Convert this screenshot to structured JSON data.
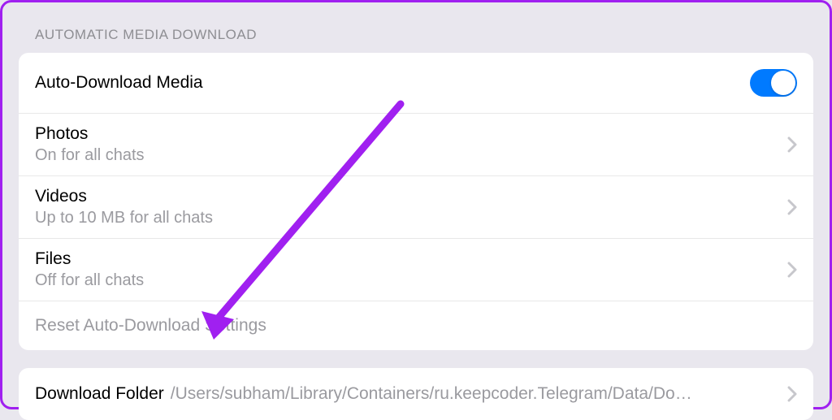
{
  "section_header": "AUTOMATIC MEDIA DOWNLOAD",
  "auto_download": {
    "label": "Auto-Download Media",
    "enabled": true
  },
  "media_types": [
    {
      "label": "Photos",
      "status": "On for all chats"
    },
    {
      "label": "Videos",
      "status": "Up to 10 MB for all chats"
    },
    {
      "label": "Files",
      "status": "Off for all chats"
    }
  ],
  "reset_label": "Reset Auto-Download Settings",
  "download_folder": {
    "label": "Download Folder",
    "path": "/Users/subham/Library/Containers/ru.keepcoder.Telegram/Data/Do…"
  }
}
